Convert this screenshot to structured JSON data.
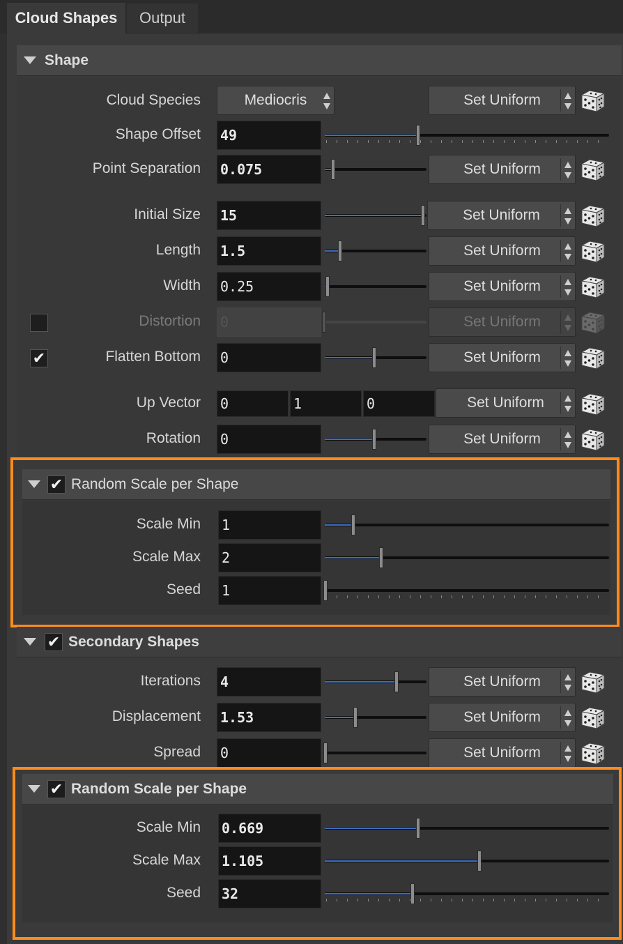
{
  "tabs": [
    "Cloud Shapes",
    "Output"
  ],
  "shape": {
    "title": "Shape",
    "cloud_species": {
      "label": "Cloud Species",
      "value": "Mediocris",
      "menu": "Set Uniform"
    },
    "shape_offset": {
      "label": "Shape Offset",
      "value": "49",
      "fill": 0.33
    },
    "point_separation": {
      "label": "Point Separation",
      "value": "0.075",
      "fill": 0.08,
      "menu": "Set Uniform"
    },
    "initial_size": {
      "label": "Initial Size",
      "value": "15",
      "fill": 1.0,
      "menu": "Set Uniform"
    },
    "length": {
      "label": "Length",
      "value": "1.5",
      "fill": 0.15,
      "menu": "Set Uniform"
    },
    "width": {
      "label": "Width",
      "value": "0.25",
      "fill": 0.02,
      "menu": "Set Uniform"
    },
    "distortion": {
      "label": "Distortion",
      "value": "0",
      "menu": "Set Uniform",
      "enabled": false
    },
    "flatten_bottom": {
      "label": "Flatten Bottom",
      "value": "0",
      "fill": 0.5,
      "menu": "Set Uniform",
      "checked": true
    },
    "up_vector": {
      "label": "Up Vector",
      "x": "0",
      "y": "1",
      "z": "0",
      "menu": "Set Uniform"
    },
    "rotation": {
      "label": "Rotation",
      "value": "0",
      "fill": 0.5,
      "menu": "Set Uniform"
    }
  },
  "random_scale_1": {
    "title": "Random Scale per Shape",
    "checked": true,
    "scale_min": {
      "label": "Scale Min",
      "value": "1",
      "fill": 0.1
    },
    "scale_max": {
      "label": "Scale Max",
      "value": "2",
      "fill": 0.2
    },
    "seed": {
      "label": "Seed",
      "value": "1",
      "fill": 0.0
    }
  },
  "secondary": {
    "title": "Secondary Shapes",
    "checked": true,
    "iterations": {
      "label": "Iterations",
      "value": "4",
      "fill": 0.73,
      "menu": "Set Uniform"
    },
    "displacement": {
      "label": "Displacement",
      "value": "1.53",
      "fill": 0.31,
      "menu": "Set Uniform"
    },
    "spread": {
      "label": "Spread",
      "value": "0",
      "fill": 0.0,
      "menu": "Set Uniform"
    }
  },
  "random_scale_2": {
    "title": "Random Scale per Shape",
    "checked": true,
    "scale_min": {
      "label": "Scale Min",
      "value": "0.669",
      "fill": 0.33
    },
    "scale_max": {
      "label": "Scale Max",
      "value": "1.105",
      "fill": 0.55
    },
    "seed": {
      "label": "Seed",
      "value": "32",
      "fill": 0.31
    }
  },
  "colors": {
    "highlight": "#ff8c1a",
    "slider_fill": "#3d6ec4"
  }
}
